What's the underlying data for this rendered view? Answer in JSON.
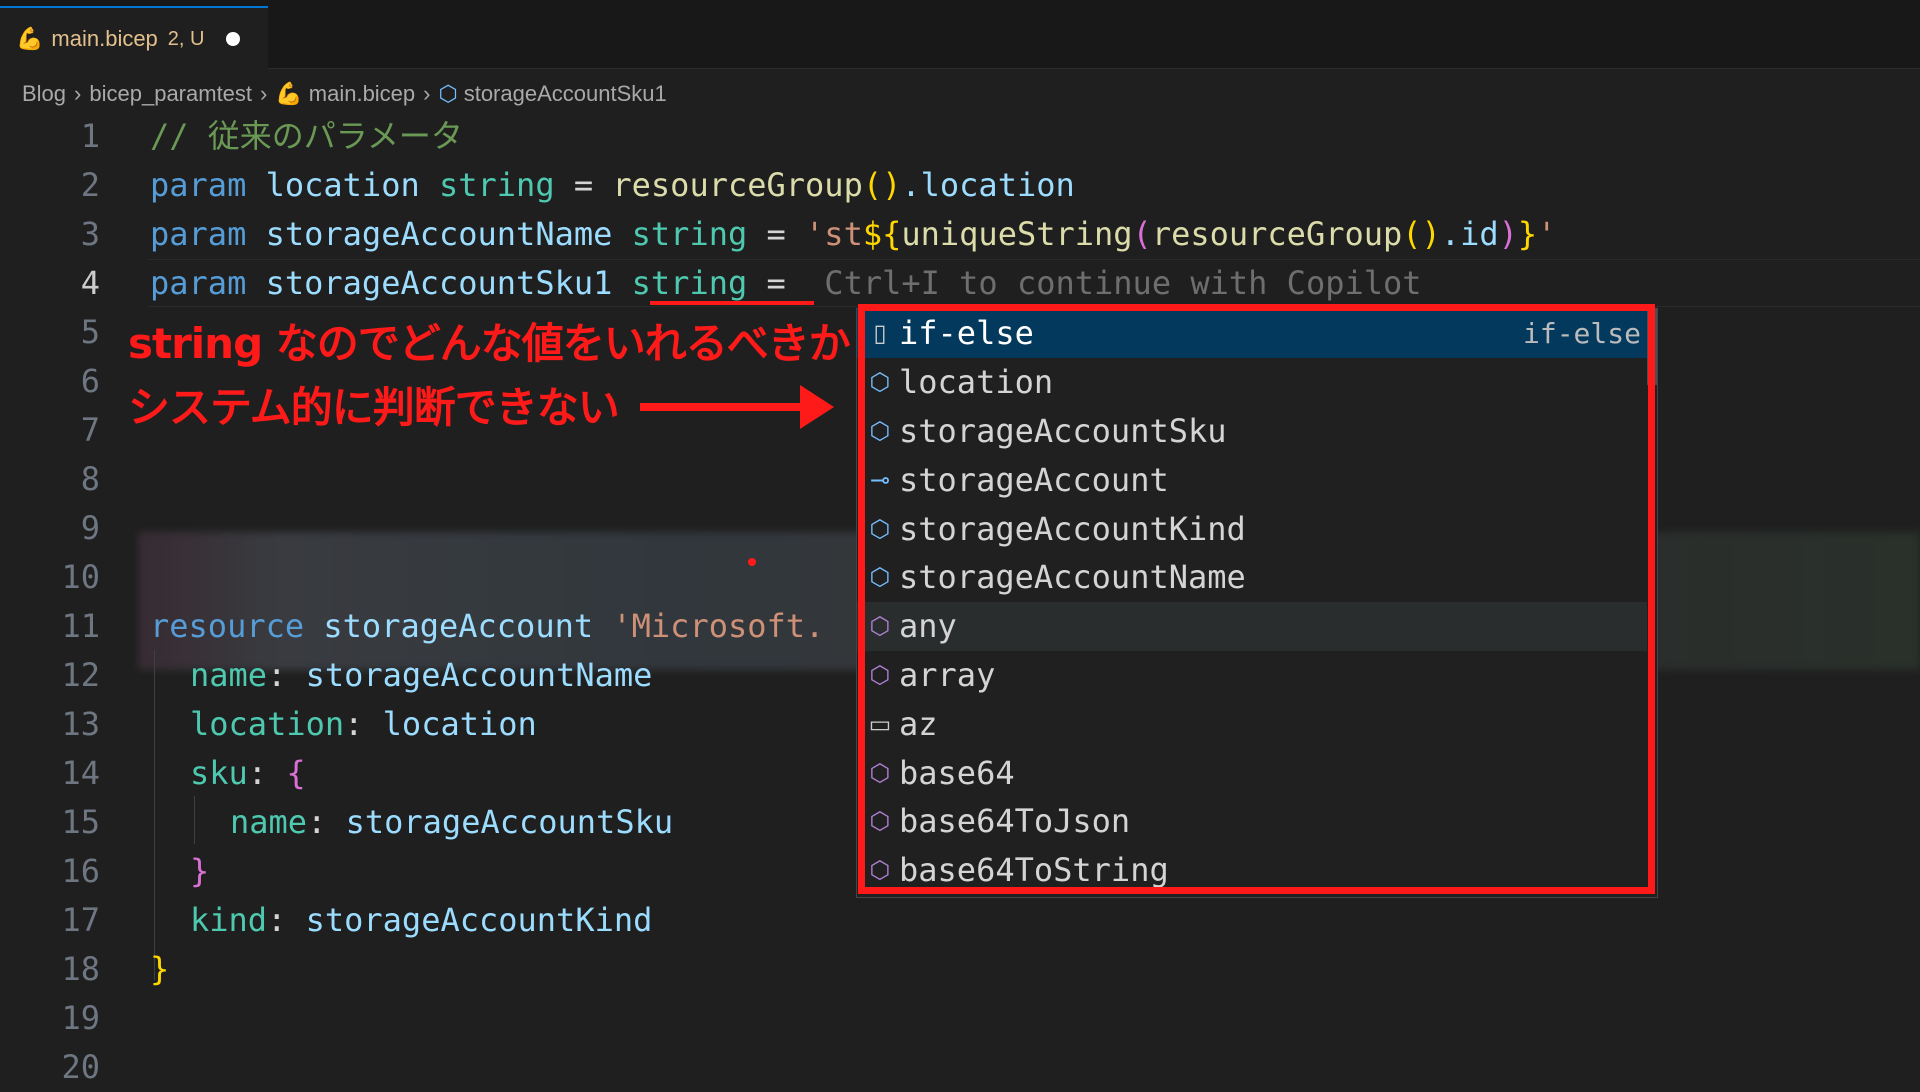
{
  "tab": {
    "icon": "bicep-file-icon",
    "name": "main.bicep",
    "status": "2, U"
  },
  "breadcrumb": [
    "Blog",
    "bicep_paramtest",
    "main.bicep",
    "storageAccountSku1"
  ],
  "line_numbers": [
    "1",
    "2",
    "3",
    "4",
    "5",
    "6",
    "7",
    "8",
    "9",
    "10",
    "11",
    "12",
    "13",
    "14",
    "15",
    "16",
    "17",
    "18",
    "19",
    "20"
  ],
  "code": {
    "l1": "// 従来のパラメータ",
    "l2": {
      "kw": "param",
      "name": "location",
      "type": "string",
      "eq": "=",
      "fn": "resourceGroup",
      "open": "(",
      "close": ")",
      "rest": ".location"
    },
    "l3": {
      "kw": "param",
      "name": "storageAccountName",
      "type": "string",
      "eq": "=",
      "str1": "'st",
      "interp_open": "${",
      "fn1": "uniqueString",
      "p1": "(",
      "fn2": "resourceGroup",
      "p2": "()",
      "rest": ".id",
      "p3": ")",
      "interp_close": "}",
      "str2": "'"
    },
    "l4": {
      "kw": "param",
      "name": "storageAccountSku1",
      "type": "string",
      "eq": "=",
      "ghost": "Ctrl+I to continue with Copilot"
    },
    "l11": {
      "kw": "resource",
      "name": "storageAccount",
      "str": "'Microsoft."
    },
    "l12": {
      "prop": "name",
      "colon": ":",
      "val": "storageAccountName"
    },
    "l13": {
      "prop": "location",
      "colon": ":",
      "val": "location"
    },
    "l14": {
      "prop": "sku",
      "colon": ":",
      "brace": "{"
    },
    "l15": {
      "prop": "name",
      "colon": ":",
      "val": "storageAccountSku"
    },
    "l16": {
      "brace": "}"
    },
    "l17": {
      "prop": "kind",
      "colon": ":",
      "val": "storageAccountKind"
    },
    "l18": {
      "brace": "}"
    }
  },
  "annotation": {
    "line1": "string なのでどんな値をいれるべきか",
    "line2": "システム的に判断できない"
  },
  "suggestions": [
    {
      "icon": "snippet-icon",
      "label": "if-else",
      "detail": "if-else"
    },
    {
      "icon": "cube-icon",
      "label": "location"
    },
    {
      "icon": "cube-icon",
      "label": "storageAccountSku"
    },
    {
      "icon": "symbol-variable-icon",
      "label": "storageAccount"
    },
    {
      "icon": "cube-icon",
      "label": "storageAccountKind"
    },
    {
      "icon": "cube-icon",
      "label": "storageAccountName"
    },
    {
      "icon": "cube-icon",
      "label": "any"
    },
    {
      "icon": "cube-icon",
      "label": "array"
    },
    {
      "icon": "folder-icon",
      "label": "az"
    },
    {
      "icon": "cube-icon",
      "label": "base64"
    },
    {
      "icon": "cube-icon",
      "label": "base64ToJson"
    },
    {
      "icon": "cube-icon",
      "label": "base64ToString"
    }
  ],
  "colors": {
    "highlight": "#ff1a1a",
    "selection": "#04395e",
    "accent": "#0078d4"
  }
}
